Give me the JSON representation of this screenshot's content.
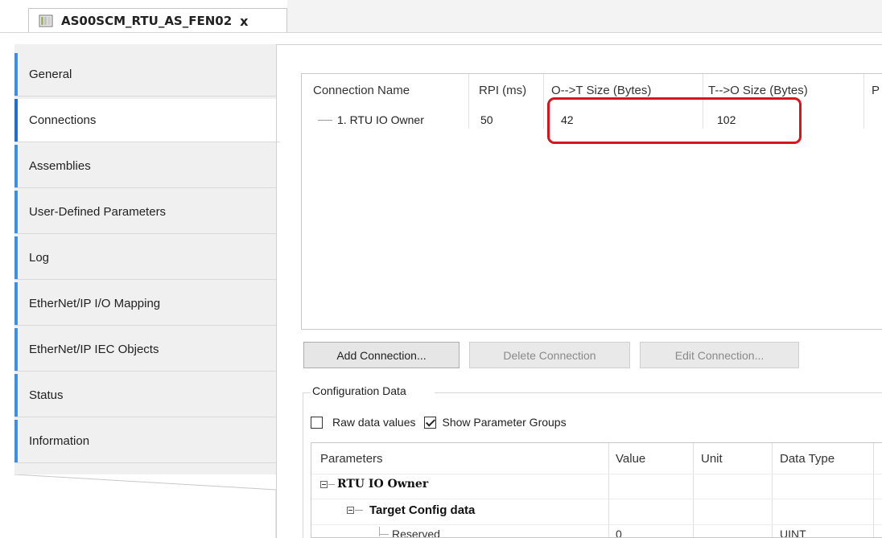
{
  "tab": {
    "title": "AS00SCM_RTU_AS_FEN02",
    "close": "x"
  },
  "nav": {
    "items": [
      {
        "label": "General"
      },
      {
        "label": "Connections"
      },
      {
        "label": "Assemblies"
      },
      {
        "label": "User-Defined Parameters"
      },
      {
        "label": "Log"
      },
      {
        "label": "EtherNet/IP I/O Mapping"
      },
      {
        "label": "EtherNet/IP IEC Objects"
      },
      {
        "label": "Status"
      },
      {
        "label": "Information"
      }
    ],
    "active": "Connections"
  },
  "connections": {
    "headers": [
      "Connection Name",
      "RPI (ms)",
      "O-->T Size (Bytes)",
      "T-->O Size (Bytes)",
      "P"
    ],
    "rows": [
      {
        "name": "1. RTU IO Owner",
        "rpi": "50",
        "ot_size": "42",
        "to_size": "102"
      }
    ]
  },
  "buttons": {
    "add": "Add Connection...",
    "delete": "Delete Connection",
    "edit": "Edit Connection..."
  },
  "config": {
    "title": "Configuration Data",
    "raw_label": "Raw data values",
    "raw_checked": false,
    "groups_label": "Show Parameter Groups",
    "groups_checked": true,
    "headers": [
      "Parameters",
      "Value",
      "Unit",
      "Data Type"
    ],
    "rows": [
      {
        "name": "RTU IO Owner",
        "value": "",
        "unit": "",
        "type": ""
      },
      {
        "name": "Target Config data",
        "value": "",
        "unit": "",
        "type": ""
      },
      {
        "name": "Reserved",
        "value": "0",
        "unit": "",
        "type": "UINT"
      }
    ]
  },
  "colors": {
    "highlight": "#d9141c",
    "nav_accent": "#3f8fe0"
  }
}
